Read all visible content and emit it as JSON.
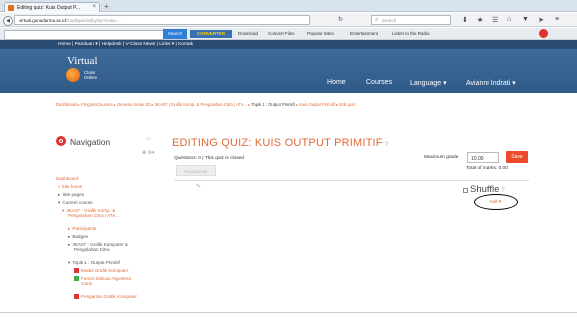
{
  "browser": {
    "tab_title": "Editing quiz: Kuis Output P...",
    "tab_close": "×",
    "new_tab": "+",
    "url_host": "virtual.gunadarma.ac.id",
    "url_path": "/mod/quiz/edit.php?cmid=...",
    "search_placeholder": "Search",
    "search_button": "Search",
    "converter_label": "CONVERTER",
    "toolbar_items": [
      "Download",
      "Convert Files",
      "Popular Sites",
      "Entertainment",
      "Listen to the Radio"
    ]
  },
  "site": {
    "top_links": "Home | Panduan ▾ | Helpdesk | V-Class News | Links ▾ | Kontak",
    "logo_word": "Virtual",
    "logo_sub1": "Class",
    "logo_sub2": "Online",
    "nav_home": "Home",
    "nav_courses": "Courses",
    "nav_language": "Language ▾",
    "nav_user": "Avianni Indrati ▾"
  },
  "breadcrumb": {
    "path": "Dashboard ▸ ProgramCourses ▸ Genesis Kelas 2D ▸ 3KA07 | Grafik Komp. & Pengolahan Citra | ATA... ▸",
    "current": "Topik 1 : Output Primitif",
    "tail": "▸ Kuis Output Primitif ▸ Edit quiz"
  },
  "navigation": {
    "title": "Navigation",
    "dashboard": "Dashboard",
    "site_home": "Site home",
    "site_pages": "Site pages",
    "current_course": "Current course",
    "course_name_1": "3KA07 - Grafik Komp. &",
    "course_name_2": "Pengolahan Citra | ATA...",
    "participants": "Participants",
    "badges": "Badges",
    "course_short_1": "3KA07 - Grafik Komputer &",
    "course_short_2": "Pengolahan Citra",
    "topic": "Topik 1 : Output Primitif",
    "modul": "Modul Grafik Komputer",
    "forum_1": "Forum Diskusi Algoritma",
    "forum_2": "Garis",
    "pengantar": "Pengantar Grafik Komputer"
  },
  "editor": {
    "heading": "EDITING QUIZ: KUIS OUTPUT PRIMITIF",
    "info": "Questions: 0 | This quiz is closed",
    "max_grade_label": "Maximum grade",
    "max_grade_value": "10.00",
    "save_button": "Save",
    "total_marks": "Total of marks: 0.00",
    "repaginate": "Repaginate",
    "shuffle": "Shuffle",
    "add_link": "Add ▾"
  }
}
